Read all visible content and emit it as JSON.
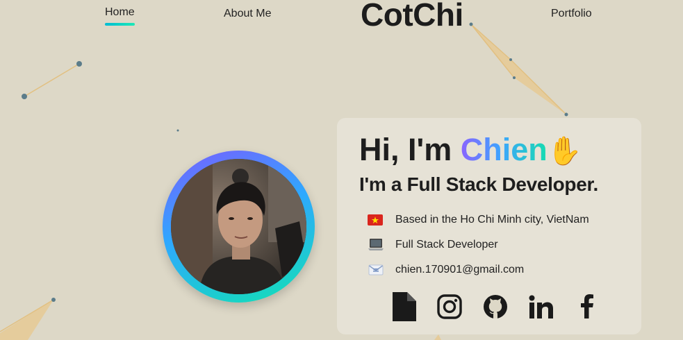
{
  "nav": {
    "home": "Home",
    "about": "About Me",
    "logo": "CotChi",
    "portfolio": "Portfolio"
  },
  "hero": {
    "greeting_prefix": "Hi, I'm ",
    "name": "Chien",
    "wave": "✋",
    "role": "I'm a Full Stack Developer."
  },
  "info": {
    "location": "Based in the Ho Chi Minh city, VietNam",
    "job": "Full Stack Developer",
    "email": "chien.170901@gmail.com"
  },
  "icons": {
    "flag": "vietnam-flag-icon",
    "job": "laptop-icon",
    "email": "envelope-icon"
  },
  "socials": [
    {
      "name": "resume-document-icon"
    },
    {
      "name": "instagram-icon"
    },
    {
      "name": "github-icon"
    },
    {
      "name": "linkedin-icon"
    },
    {
      "name": "facebook-icon"
    }
  ],
  "colors": {
    "background": "#ddd8c7",
    "accent_start": "#8a63ff",
    "accent_mid": "#3fa3ff",
    "accent_end": "#15dcb0",
    "text": "#1e1e1e"
  }
}
